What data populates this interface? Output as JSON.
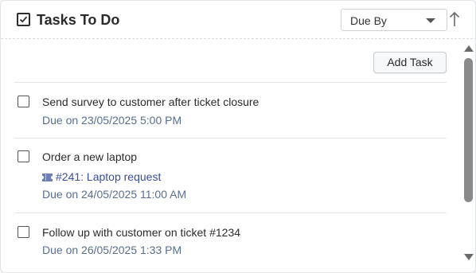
{
  "header": {
    "title": "Tasks To Do",
    "sort_selected": "Due By",
    "sort_direction": "ascending"
  },
  "toolbar": {
    "add_task_label": "Add Task"
  },
  "tasks": [
    {
      "title": "Send survey to customer after ticket closure",
      "due": "Due on 23/05/2025 5:00 PM"
    },
    {
      "title": "Order a new laptop",
      "ticket": "#241: Laptop request",
      "due": "Due on 24/05/2025 11:00 AM"
    },
    {
      "title": "Follow up with customer on ticket #1234",
      "due": "Due on 26/05/2025 1:33 PM"
    }
  ],
  "colors": {
    "due_text": "#5a6f8e",
    "ticket_link": "#3a4e9c",
    "scrollbar": "#8a8a8a"
  },
  "icons": {
    "title": "checkbox-checked-icon",
    "sort_direction": "arrow-up-icon",
    "ticket": "ticket-icon"
  }
}
